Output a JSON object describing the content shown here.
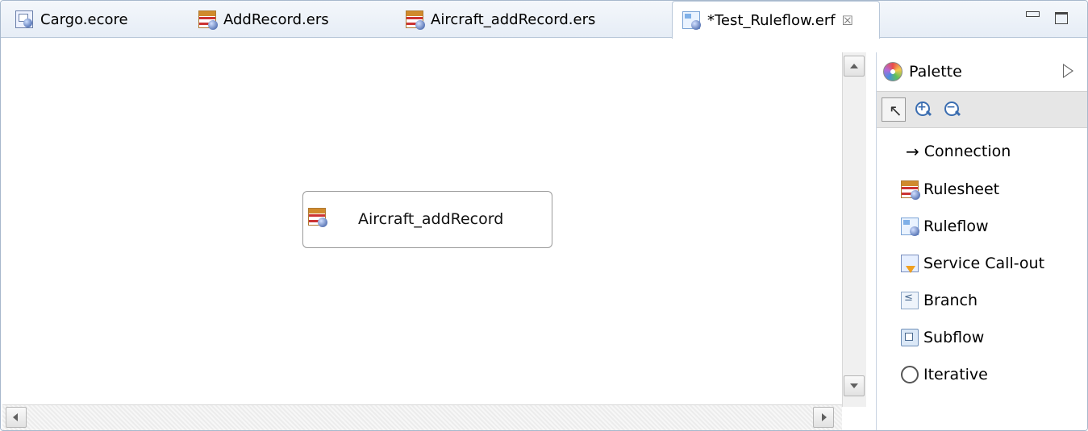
{
  "tabs": [
    {
      "label": "Cargo.ecore",
      "icon": "ecore-icon",
      "active": false
    },
    {
      "label": "AddRecord.ers",
      "icon": "rulesheet-icon",
      "active": false
    },
    {
      "label": "Aircraft_addRecord.ers",
      "icon": "rulesheet-icon",
      "active": false
    },
    {
      "label": "*Test_Ruleflow.erf",
      "icon": "ruleflow-icon",
      "active": true,
      "close": "☒"
    }
  ],
  "canvas": {
    "node": {
      "label": "Aircraft_addRecord",
      "icon": "rulesheet-icon"
    }
  },
  "palette": {
    "title": "Palette",
    "items": [
      {
        "label": "Connection",
        "icon": "arrow-right-icon",
        "glyph": "→"
      },
      {
        "label": "Rulesheet",
        "icon": "rulesheet-icon"
      },
      {
        "label": "Ruleflow",
        "icon": "ruleflow-icon"
      },
      {
        "label": "Service Call-out",
        "icon": "service-callout-icon"
      },
      {
        "label": "Branch",
        "icon": "branch-icon"
      },
      {
        "label": "Subflow",
        "icon": "subflow-icon"
      },
      {
        "label": "Iterative",
        "icon": "iterative-icon"
      }
    ]
  },
  "colors": {
    "tab_bar": "#e6edf6",
    "border": "#a7b8cc",
    "palette_tools_bg": "#e6e6e6"
  }
}
